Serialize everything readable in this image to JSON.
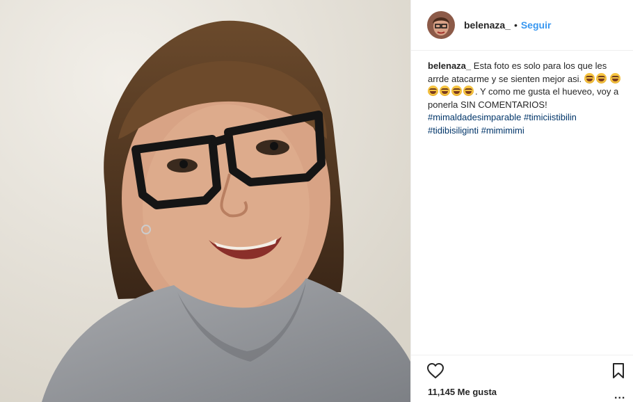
{
  "post": {
    "username": "belenaza_",
    "follow_label": "Seguir",
    "separator": "•",
    "caption": {
      "username": "belenaza_",
      "text_1": "Esta foto es solo para los que les arrde atacarme y se sienten mejor asi.",
      "text_2": ". Y como me gusta el hueveo, voy a ponerla SIN COMENTARIOS!",
      "hashtags": [
        "#mimaldadesimparable",
        "#timiciistibilin",
        "#tidibisiliginti",
        "#mimimimi"
      ],
      "emoji_name": "grinning-squinting-face-emoji"
    },
    "likes_label": "11,145 Me gusta",
    "more_label": "..."
  },
  "colors": {
    "link_blue": "#3897f0",
    "hashtag_navy": "#003569",
    "text": "#262626",
    "border": "#efefef"
  },
  "icons": {
    "like": "heart-icon",
    "save": "bookmark-icon",
    "options": "more-options-icon"
  }
}
